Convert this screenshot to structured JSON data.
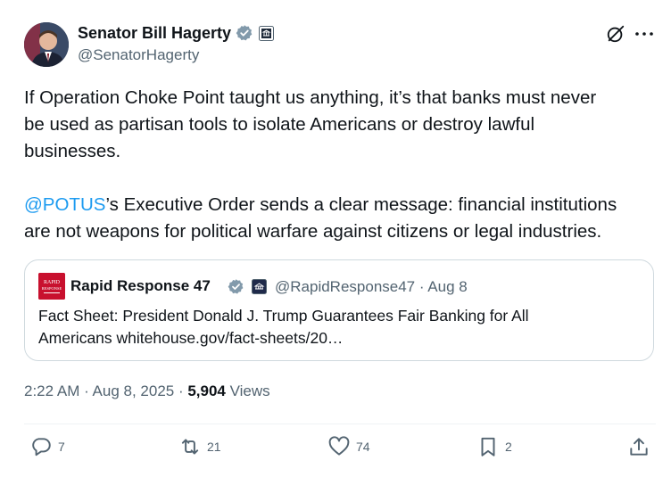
{
  "author": {
    "display_name": "Senator Bill Hagerty",
    "handle": "@SenatorHagerty",
    "avatar_icon": "senator-portrait",
    "verified_icon": "verified-badge-icon",
    "affiliation_icon": "senate-seal-icon"
  },
  "tweet": {
    "paragraph1_lines": [
      "If Operation Choke Point taught us anything, it’s that banks must never",
      "be used as partisan tools to isolate Americans or destroy lawful",
      "businesses."
    ],
    "mention": "@POTUS",
    "paragraph2_line1_rest": "’s Executive Order sends a clear message: financial institutions",
    "paragraph2_line2": "are not weapons for political warfare against citizens or legal industries."
  },
  "quoted": {
    "display_name": "Rapid Response 47",
    "handle_and_date": "@RapidResponse47 · Aug 8",
    "text_lines": [
      "Fact Sheet: President Donald J. Trump Guarantees Fair Banking for All",
      "Americans whitehouse.gov/fact-sheets/20…"
    ],
    "avatar_label": "RAPID RESPONSE"
  },
  "meta": {
    "time_date": "2:22 AM · Aug 8, 2025 · ",
    "views_count": "5,904",
    "views_label": " Views"
  },
  "actions": {
    "replies": "7",
    "reposts": "21",
    "likes": "74",
    "bookmarks": "2"
  },
  "colors": {
    "accent": "#1d9bf0",
    "secondary_text": "#536471",
    "border": "#cfd9de"
  }
}
